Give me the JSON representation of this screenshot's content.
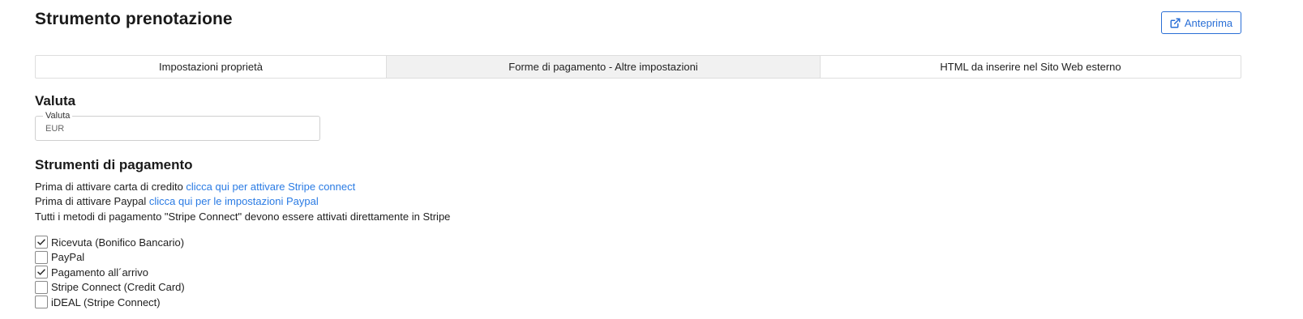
{
  "page": {
    "title": "Strumento prenotazione",
    "preview_label": "Anteprima"
  },
  "tabs": [
    {
      "label": "Impostazioni proprietà",
      "active": false
    },
    {
      "label": "Forme di pagamento - Altre impostazioni",
      "active": true
    },
    {
      "label": "HTML da inserire nel Sito Web esterno",
      "active": false
    }
  ],
  "currency": {
    "section_title": "Valuta",
    "field_label": "Valuta",
    "value": "EUR"
  },
  "payment": {
    "section_title": "Strumenti di pagamento",
    "line1_text": "Prima di attivare carta di credito ",
    "line1_link": "clicca qui per attivare Stripe connect",
    "line2_text": "Prima di attivare Paypal ",
    "line2_link": "clicca qui per le impostazioni Paypal",
    "line3_text": "Tutti i metodi di pagamento \"Stripe Connect\" devono essere attivati direttamente in Stripe",
    "methods": [
      {
        "label": "Ricevuta (Bonifico Bancario)",
        "checked": true
      },
      {
        "label": "PayPal",
        "checked": false
      },
      {
        "label": "Pagamento all´arrivo",
        "checked": true
      },
      {
        "label": "Stripe Connect (Credit Card)",
        "checked": false
      },
      {
        "label": "iDEAL (Stripe Connect)",
        "checked": false
      }
    ]
  },
  "colors": {
    "accent": "#2a6fd6",
    "link": "#2a7be4",
    "active_tab_bg": "#f1f1f1",
    "border": "#dedede"
  },
  "icons": {
    "preview": "external-link-icon",
    "check": "checkmark-icon"
  }
}
